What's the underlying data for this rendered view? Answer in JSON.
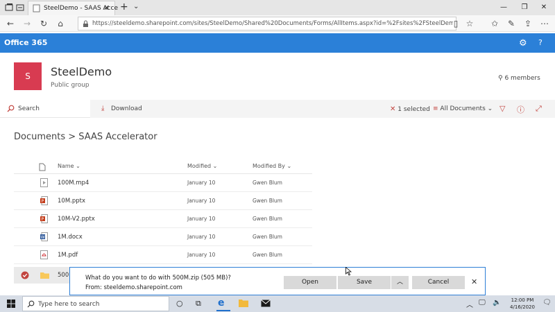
{
  "browser": {
    "tab_title": "SteelDemo - SAAS Acce",
    "url": "https://steeldemo.sharepoint.com/sites/SteelDemo/Shared%20Documents/Forms/AllItems.aspx?id=%2Fsites%2FSteelDemo%2FShared%20Doc"
  },
  "o365": {
    "title": "Office 365"
  },
  "site": {
    "logo_letter": "S",
    "name": "SteelDemo",
    "subtitle": "Public group",
    "members": "6 members"
  },
  "commandbar": {
    "search_label": "Search",
    "download_label": "Download",
    "selected": "1 selected",
    "view": "All Documents"
  },
  "breadcrumb": "Documents  >  SAAS Accelerator",
  "table": {
    "headers": {
      "name": "Name",
      "modified": "Modified",
      "modified_by": "Modified By"
    },
    "rows": [
      {
        "name": "100M.mp4",
        "modified": "January 10",
        "modified_by": "Gwen Blum",
        "icon": "video-file-icon"
      },
      {
        "name": "10M.pptx",
        "modified": "January 10",
        "modified_by": "Gwen Blum",
        "icon": "powerpoint-file-icon"
      },
      {
        "name": "10M-V2.pptx",
        "modified": "January 10",
        "modified_by": "Gwen Blum",
        "icon": "powerpoint-file-icon"
      },
      {
        "name": "1M.docx",
        "modified": "January 10",
        "modified_by": "Gwen Blum",
        "icon": "word-file-icon"
      },
      {
        "name": "1M.pdf",
        "modified": "January 10",
        "modified_by": "Gwen Blum",
        "icon": "pdf-file-icon"
      },
      {
        "name": "500M",
        "modified": "",
        "modified_by": "",
        "icon": "folder-icon",
        "selected": true
      }
    ]
  },
  "download_dialog": {
    "question": "What do you want to do with 500M.zip (505 MB)?",
    "from": "From: steeldemo.sharepoint.com",
    "open_label": "Open",
    "save_label": "Save",
    "cancel_label": "Cancel"
  },
  "taskbar": {
    "search_placeholder": "Type here to search",
    "time": "12:00 PM",
    "date": "4/16/2020"
  },
  "colors": {
    "accent": "#2b80d8",
    "site_logo": "#d83b51",
    "dialog_border": "#2d7fd6"
  }
}
